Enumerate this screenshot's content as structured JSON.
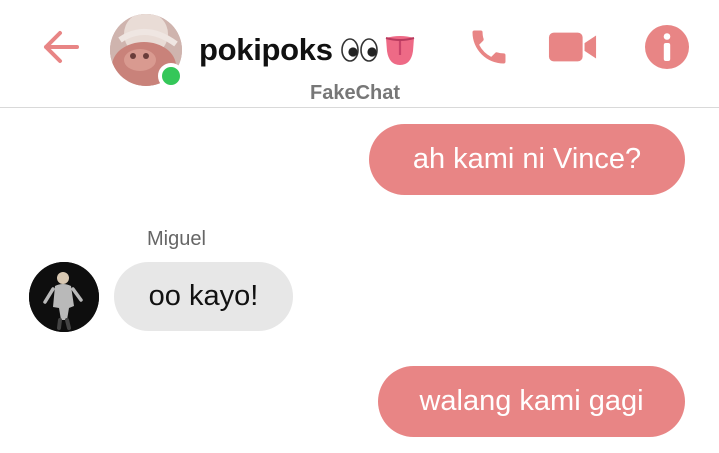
{
  "header": {
    "contact_name": "pokipoks",
    "contact_emoji": "👀👅",
    "subtitle": "FakeChat",
    "online": true,
    "icons": {
      "back": "back-arrow-icon",
      "call": "phone-icon",
      "video": "video-camera-icon",
      "info": "info-icon"
    }
  },
  "colors": {
    "accent": "#e88585",
    "outgoing_bubble": "#e88585",
    "incoming_bubble": "#e7e7e7",
    "online": "#34c759"
  },
  "messages": [
    {
      "direction": "outgoing",
      "text": "ah kami ni Vince?"
    },
    {
      "direction": "incoming",
      "sender": "Miguel",
      "text": "oo kayo!"
    },
    {
      "direction": "outgoing",
      "text": "walang kami gagi"
    }
  ]
}
